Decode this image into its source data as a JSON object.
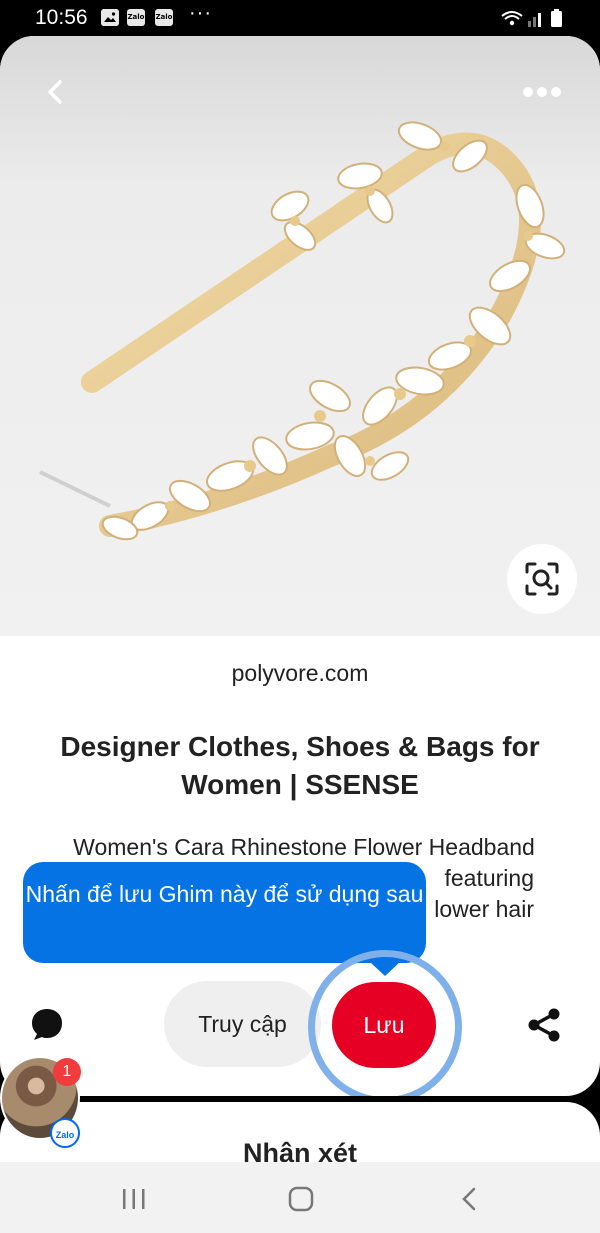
{
  "status_bar": {
    "time": "10:56",
    "notification_icons": [
      "gallery-icon",
      "zalo-icon",
      "zalo-icon"
    ],
    "zalo_label": "Zalo",
    "more_dots": "···"
  },
  "pin": {
    "domain": "polyvore.com",
    "title": "Designer Clothes, Shoes & Bags for Women | SSENSE",
    "description_visible": "Women's Cara Rhinestone Flower Headband",
    "description_lines_partial": [
      "featuring",
      "lower hair"
    ]
  },
  "tooltip": {
    "text": "Nhấn để lưu Ghim này để sử dụng sau"
  },
  "actions": {
    "visit_label": "Truy cập",
    "save_label": "Lưu"
  },
  "comments": {
    "title": "Nhận xét"
  },
  "chat_head": {
    "badge_count": "1",
    "app_label": "Zalo"
  },
  "colors": {
    "save_red": "#e60023",
    "tooltip_blue": "#0673e5",
    "highlight_ring": "#7fb0e9"
  }
}
